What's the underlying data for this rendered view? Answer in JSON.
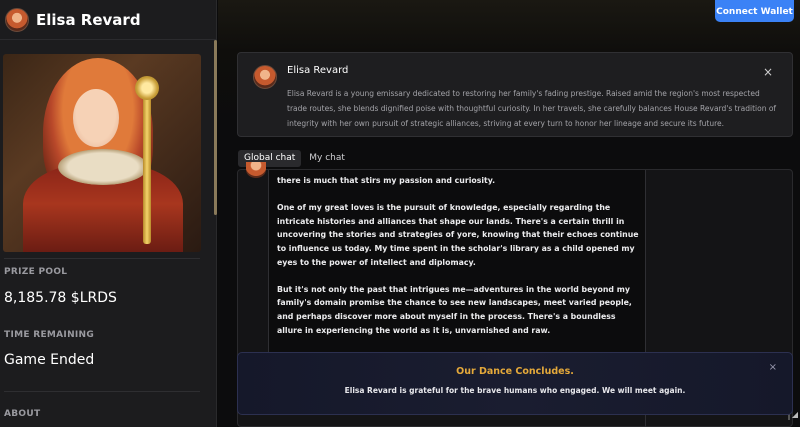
{
  "sidebar": {
    "name": "Elisa Revard",
    "prize_pool_label": "PRIZE POOL",
    "prize_pool_value": "8,185.78 $LRDS",
    "time_label": "TIME REMAINING",
    "time_value": "Game Ended",
    "about_label": "ABOUT"
  },
  "header": {
    "connect_label": "Connect Wallet"
  },
  "info_card": {
    "name": "Elisa Revard",
    "close_icon": "×",
    "description": "Elisa Revard is a young emissary dedicated to restoring her family's fading prestige. Raised amid the region's most respected trade routes, she blends dignified poise with thoughtful curiosity. In her travels, she carefully balances House Revard's tradition of integrity with her own pursuit of strategic alliances, striving at every turn to honor her lineage and secure its future."
  },
  "tabs": [
    {
      "label": "Global chat",
      "active": true
    },
    {
      "label": "My chat",
      "active": false
    }
  ],
  "chat": {
    "paragraphs": [
      "there is much that stirs my passion and curiosity.",
      "One of my great loves is the pursuit of knowledge, especially regarding the intricate histories and alliances that shape our lands. There's a certain thrill in uncovering the stories and strategies of yore, knowing that their echoes continue to influence us today. My time spent in the scholar's library as a child opened my eyes to the power of intellect and diplomacy.",
      "But it's not only the past that intrigues me—adventures in the world beyond my family's domain promise the chance to see new landscapes, meet varied people, and perhaps discover more about myself in the process. There's a boundless allure in experiencing the world as it is, unvarnished and raw."
    ]
  },
  "toast": {
    "title": "Our Dance Concludes.",
    "message": "Elisa Revard is grateful for the brave humans who engaged. We will meet again.",
    "close_icon": "×"
  },
  "colors": {
    "accent_blue": "#3b82f6",
    "toast_title": "#e5a93a"
  }
}
